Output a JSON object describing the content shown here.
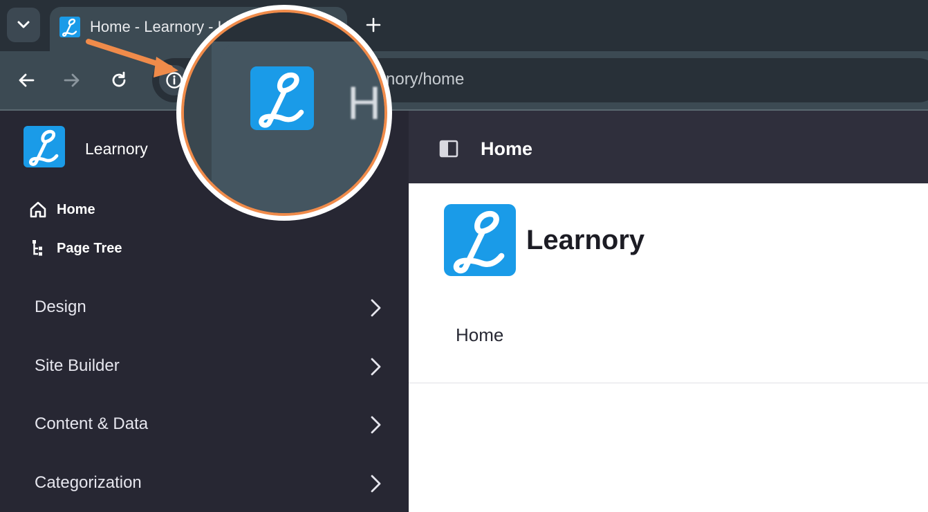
{
  "browser": {
    "tab": {
      "title": "Home - Learnory - Li",
      "favicon": "learnory-logo"
    },
    "address_bar": {
      "url": "rnory/home"
    },
    "icons": {
      "tab_search": "chevron-down-icon",
      "new_tab": "plus-icon",
      "back": "arrow-left-icon",
      "forward": "arrow-right-icon",
      "reload": "reload-icon",
      "site_info": "info-icon"
    }
  },
  "sidebar": {
    "site_name": "Learnory",
    "nav": [
      {
        "label": "Home",
        "icon": "home-icon"
      },
      {
        "label": "Page Tree",
        "icon": "page-tree-icon"
      }
    ],
    "sections": [
      {
        "label": "Design"
      },
      {
        "label": "Site Builder"
      },
      {
        "label": "Content & Data"
      },
      {
        "label": "Categorization"
      }
    ]
  },
  "main": {
    "header_title": "Home",
    "site_name": "Learnory",
    "nav_link": "Home"
  },
  "callout": {
    "zoom_letter": "H"
  },
  "colors": {
    "accent_orange": "#f08b4a",
    "logo_blue": "#1a9be8",
    "sidebar_bg": "#272733",
    "header_bg": "#2f2f3c",
    "chrome_dark": "#283038",
    "chrome_toolbar": "#3c4a53"
  }
}
